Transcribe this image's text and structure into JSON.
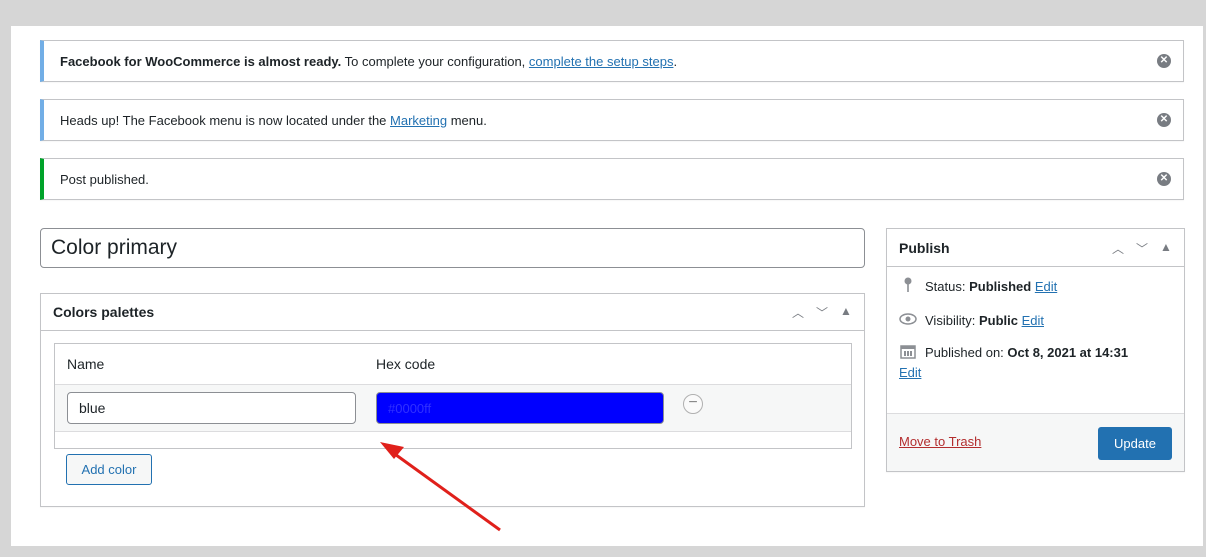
{
  "notices": [
    {
      "bold": "Facebook for WooCommerce is almost ready.",
      "text": " To complete your configuration, ",
      "link": "complete the setup steps",
      "tail": "."
    },
    {
      "text": "Heads up! The Facebook menu is now located under the ",
      "link": "Marketing",
      "tail": " menu."
    },
    {
      "text": "Post published."
    }
  ],
  "dismiss_glyph": "✕",
  "title_value": "Color primary",
  "colors_box": {
    "title": "Colors palettes",
    "col_name": "Name",
    "col_hex": "Hex code",
    "row": {
      "name": "blue",
      "hex": "#0000ff"
    },
    "remove_glyph": "−",
    "add_label": "Add color"
  },
  "handle_actions": {
    "up": "︿",
    "down": "﹀",
    "toggle": "▲"
  },
  "publish": {
    "title": "Publish",
    "status_label": "Status: ",
    "status_value": "Published",
    "visibility_label": "Visibility: ",
    "visibility_value": "Public",
    "published_label": "Published on: ",
    "published_value": "Oct 8, 2021 at 14:31",
    "edit": "Edit",
    "trash": "Move to Trash",
    "update": "Update"
  },
  "icons": {
    "pin": "pin-icon",
    "eye": "eye-icon",
    "calendar": "calendar-icon"
  },
  "colors": {
    "accent": "#2271b1",
    "success": "#00a32a",
    "info": "#72aee6",
    "danger": "#b32d2e",
    "swatch": "#0000ff",
    "arrow": "#e0201b"
  }
}
